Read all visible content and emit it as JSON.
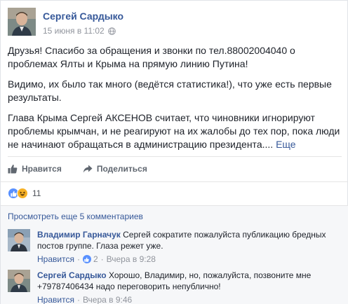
{
  "post": {
    "author": "Сергей Сардыко",
    "time": "15 июня в 11:02",
    "paragraphs": [
      "Друзья! Спасибо за обращения и звонки по тел.88002004040 о проблемах Ялты и Крыма на прямую линию Путина!",
      "Видимо, их было так много (ведётся статистика!), что уже есть первые результаты.",
      "Глава Крыма Сергей АКСЕНОВ считает, что чиновники игнорируют проблемы крымчан, и не реагируют на их жалобы до тех пор, пока люди не начинают обращаться в администрацию президента...."
    ],
    "more_label": "Еще"
  },
  "actions": {
    "like_label": "Нравится",
    "share_label": "Поделиться"
  },
  "reactions": {
    "count": "11",
    "icons": [
      "like-icon",
      "haha-icon"
    ]
  },
  "comments_section": {
    "view_more": "Просмотреть еще 5 комментариев",
    "items": [
      {
        "author": "Владимир Гарначук",
        "text": "Сергей сократите пожалуйста публикацию бредных постов группе. Глаза режет уже.",
        "like_label": "Нравится",
        "likes": "2",
        "time": "Вчера в 9:28"
      },
      {
        "author": "Сергей Сардыко",
        "text": "Хорошо, Владимир, но, пожалуйста, позвоните мне +79787406434 надо переговорить непублично!",
        "like_label": "Нравится",
        "time": "Вчера в 9:46"
      }
    ]
  },
  "colors": {
    "link": "#365899",
    "like_blue": "#5890ff",
    "haha_yellow": "#f7b125",
    "meta_gray": "#90949c"
  }
}
